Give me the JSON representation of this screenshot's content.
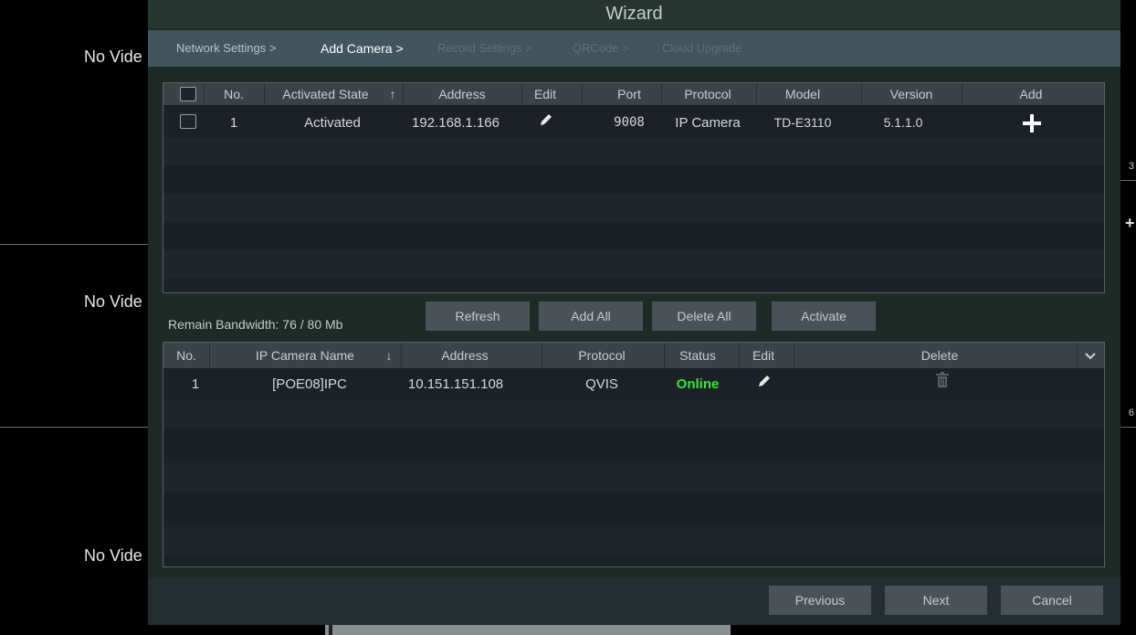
{
  "background": {
    "tiles": [
      {
        "label": "No Vide"
      },
      {
        "label": "No Vide"
      },
      {
        "label": "No Vide"
      }
    ],
    "edge_numbers": [
      "3",
      "6"
    ]
  },
  "wizard": {
    "title": "Wizard",
    "breadcrumb": {
      "network": "Network Settings >",
      "add_camera": "Add Camera >",
      "record": "Record Settings >",
      "qrcode": "QRCode >",
      "cloud": "Cloud Upgrade"
    },
    "search_table": {
      "headers": {
        "no": "No.",
        "state": "Activated State",
        "state_sort": "↑",
        "address": "Address",
        "edit": "Edit",
        "port": "Port",
        "protocol": "Protocol",
        "model": "Model",
        "version": "Version",
        "add": "Add"
      },
      "rows": [
        {
          "no": "1",
          "state": "Activated",
          "address": "192.168.1.166",
          "port": "9008",
          "protocol": "IP Camera",
          "model": "TD-E3110",
          "version": "5.1.1.0"
        }
      ]
    },
    "bandwidth": "Remain Bandwidth: 76 / 80 Mb",
    "actions": {
      "refresh": "Refresh",
      "add_all": "Add All",
      "delete_all": "Delete All",
      "activate": "Activate"
    },
    "added_table": {
      "headers": {
        "no": "No.",
        "name": "IP Camera Name",
        "name_sort": "↓",
        "address": "Address",
        "protocol": "Protocol",
        "status": "Status",
        "edit": "Edit",
        "delete": "Delete"
      },
      "rows": [
        {
          "no": "1",
          "name": "[POE08]IPC",
          "address": "10.151.151.108",
          "protocol": "QVIS",
          "status": "Online"
        }
      ]
    },
    "footer": {
      "previous": "Previous",
      "next": "Next",
      "cancel": "Cancel"
    }
  },
  "colors": {
    "online": "#33e833",
    "panel": "#1d2a25",
    "breadcrumb_bar": "#42545c"
  }
}
